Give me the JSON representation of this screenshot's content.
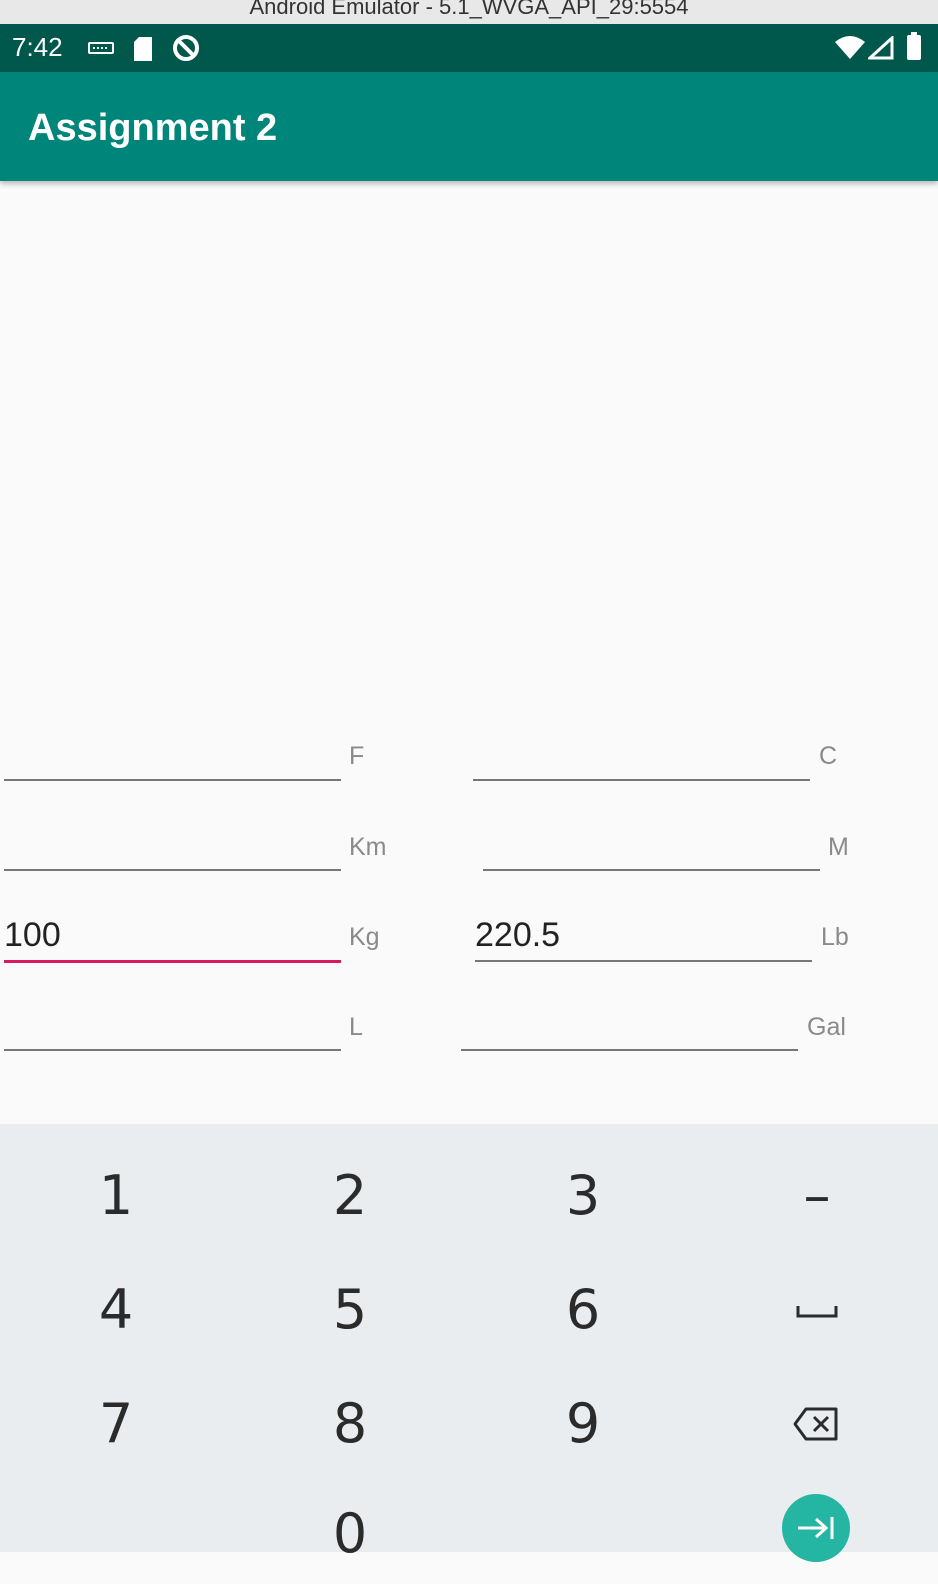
{
  "window": {
    "title": "Android Emulator - 5.1_WVGA_API_29:5554"
  },
  "status_bar": {
    "time": "7:42",
    "left_icons": [
      "keyboard-icon",
      "sd-card-icon",
      "do-not-disturb-icon"
    ],
    "right_icons": [
      "wifi-icon",
      "cellular-signal-icon",
      "battery-icon"
    ]
  },
  "app_bar": {
    "title": "Assignment 2"
  },
  "fields": {
    "fahrenheit": {
      "value": "",
      "unit": "F"
    },
    "celsius": {
      "value": "",
      "unit": "C"
    },
    "kilometers": {
      "value": "",
      "unit": "Km"
    },
    "meters": {
      "value": "",
      "unit": "M"
    },
    "kilograms": {
      "value": "100",
      "unit": "Kg",
      "focused": true
    },
    "pounds": {
      "value": "220.5",
      "unit": "Lb"
    },
    "liters": {
      "value": "",
      "unit": "L"
    },
    "gallons": {
      "value": "",
      "unit": "Gal"
    }
  },
  "keyboard": {
    "keys": {
      "k1": "1",
      "k2": "2",
      "k3": "3",
      "minus": "–",
      "k4": "4",
      "k5": "5",
      "k6": "6",
      "k7": "7",
      "k8": "8",
      "k9": "9",
      "k0": "0"
    },
    "icons": [
      "space-icon",
      "backspace-icon",
      "next-field-icon"
    ]
  },
  "colors": {
    "status_bar": "#00574b",
    "app_bar": "#00857a",
    "focus_accent": "#d81b60",
    "enter_button": "#25b5a3"
  }
}
